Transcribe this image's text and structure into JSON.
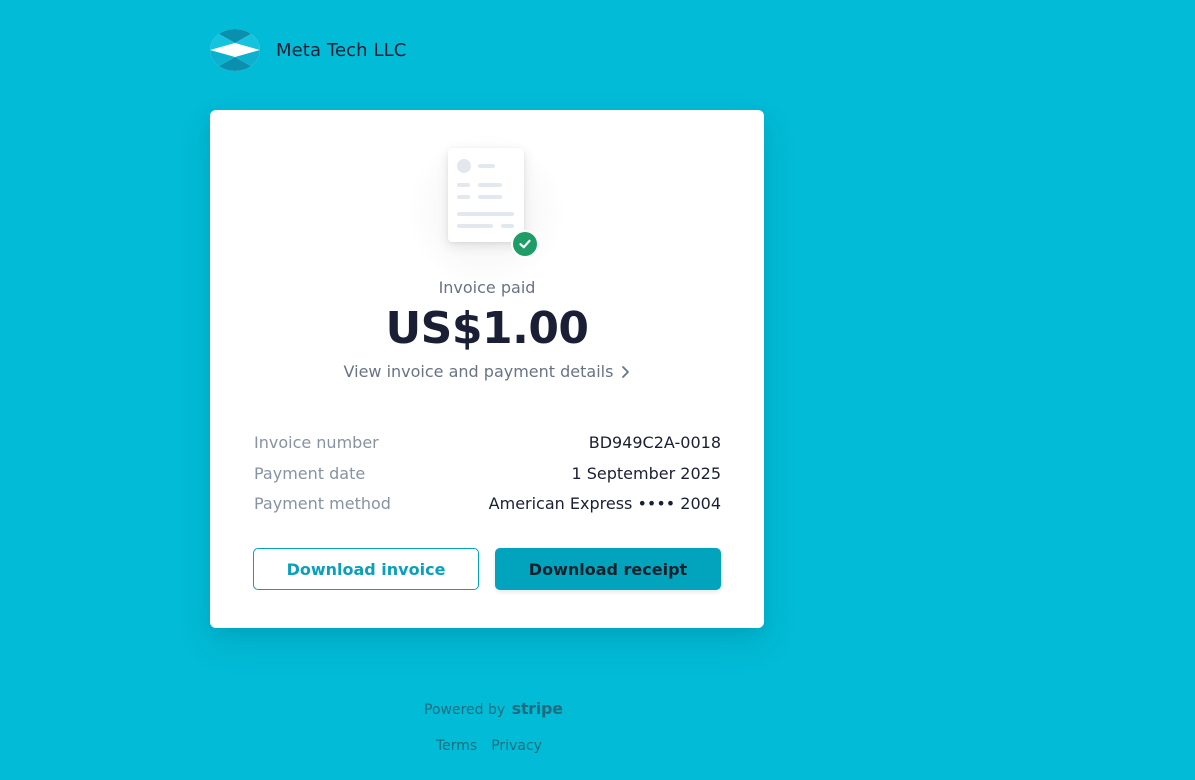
{
  "merchant": {
    "name": "Meta Tech LLC",
    "logo_icon": "meta-tech-logo-icon"
  },
  "invoice": {
    "status_label": "Invoice paid",
    "amount": "US$1.00",
    "details_link": "View invoice and payment details"
  },
  "details": [
    {
      "label": "Invoice number",
      "value": "BD949C2A-0018"
    },
    {
      "label": "Payment date",
      "value": "1 September 2025"
    },
    {
      "label": "Payment method",
      "value": "American Express •••• 2004"
    }
  ],
  "actions": {
    "download_invoice": "Download invoice",
    "download_receipt": "Download receipt"
  },
  "footer": {
    "powered_by": "Powered by",
    "powered_brand": "stripe",
    "terms": "Terms",
    "privacy": "Privacy"
  },
  "colors": {
    "background": "#02bbd6",
    "accent": "#02a3bd",
    "success": "#1f9d67"
  }
}
